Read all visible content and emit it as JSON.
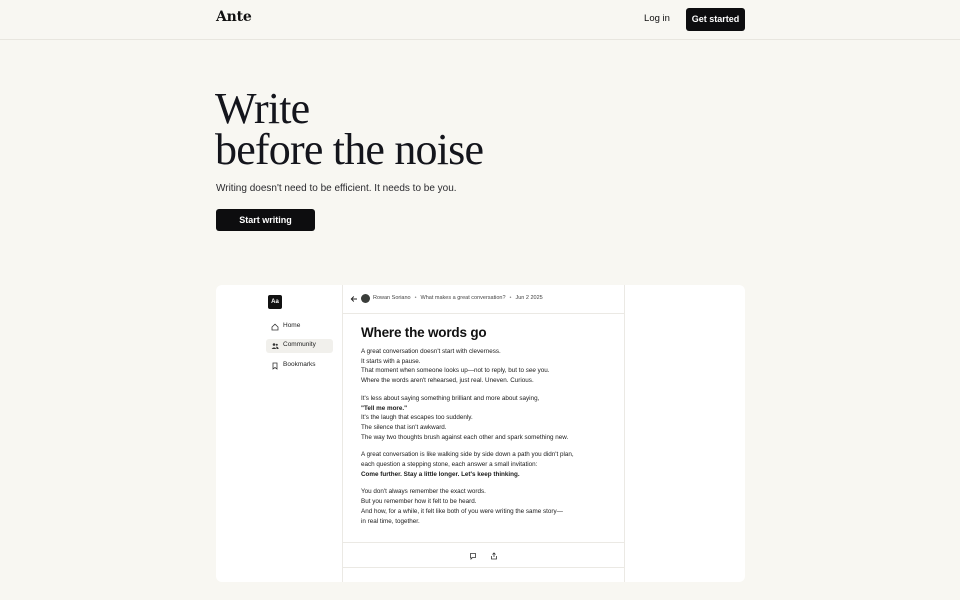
{
  "header": {
    "logo": "Ante",
    "login_label": "Log in",
    "cta_label": "Get started"
  },
  "hero": {
    "title_line1": "Write",
    "title_line2": "before the noise",
    "subtitle": "Writing doesn't need to be efficient. It needs to be you.",
    "button_label": "Start writing"
  },
  "preview": {
    "app_logo": "Aa",
    "sidebar": {
      "items": [
        {
          "label": "Home",
          "icon": "home-icon"
        },
        {
          "label": "Community",
          "icon": "users-icon",
          "active": true
        },
        {
          "label": "Bookmarks",
          "icon": "bookmark-icon"
        }
      ]
    },
    "post": {
      "author": "Rowan Soriano",
      "topic": "What makes a great conversation?",
      "date": "Jun 2 2025",
      "title": "Where the words go",
      "p1": [
        "A great conversation doesn't start with cleverness.",
        "It starts with a pause.",
        "That moment when someone looks up—not to reply, but to ",
        "see",
        " you.",
        "Where the words aren't rehearsed, just real. Uneven. Curious."
      ],
      "p2": [
        "It's less about saying something brilliant and more about saying,",
        "\"Tell me more.\"",
        "It's the laugh that escapes too suddenly.",
        "The silence that isn't awkward.",
        "The way two thoughts brush against each other and spark something new."
      ],
      "p3": [
        "A great conversation is like walking side by side down a path you didn't plan,",
        "each question a stepping stone, each answer a small invitation:",
        "Come further. Stay a little longer. Let's keep thinking."
      ],
      "p4": [
        "You don't always remember the exact words.",
        "But you remember how it felt to be heard.",
        "And how, for a while, it felt like both of you were writing the same story—",
        "in real time, together."
      ]
    }
  }
}
